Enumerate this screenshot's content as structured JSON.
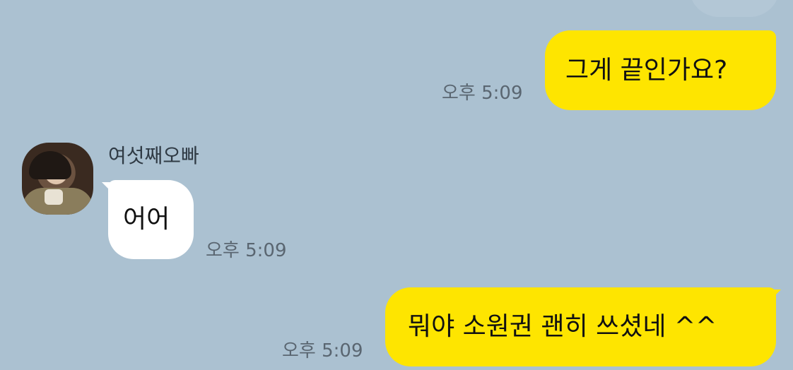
{
  "colors": {
    "background": "#abc1d1",
    "my_bubble": "#fee500",
    "their_bubble": "#ffffff",
    "timestamp": "#5a6671"
  },
  "messages": [
    {
      "direction": "outgoing",
      "text": "그게 끝인가요?",
      "time": "오후 5:09"
    },
    {
      "direction": "incoming",
      "sender": "여섯째오빠",
      "avatar": "avatar-photo",
      "text": "어어",
      "time": "오후 5:09"
    },
    {
      "direction": "outgoing",
      "text": "뭐야 소원권 괜히 쓰셨네 ^^",
      "time": "오후 5:09"
    }
  ]
}
